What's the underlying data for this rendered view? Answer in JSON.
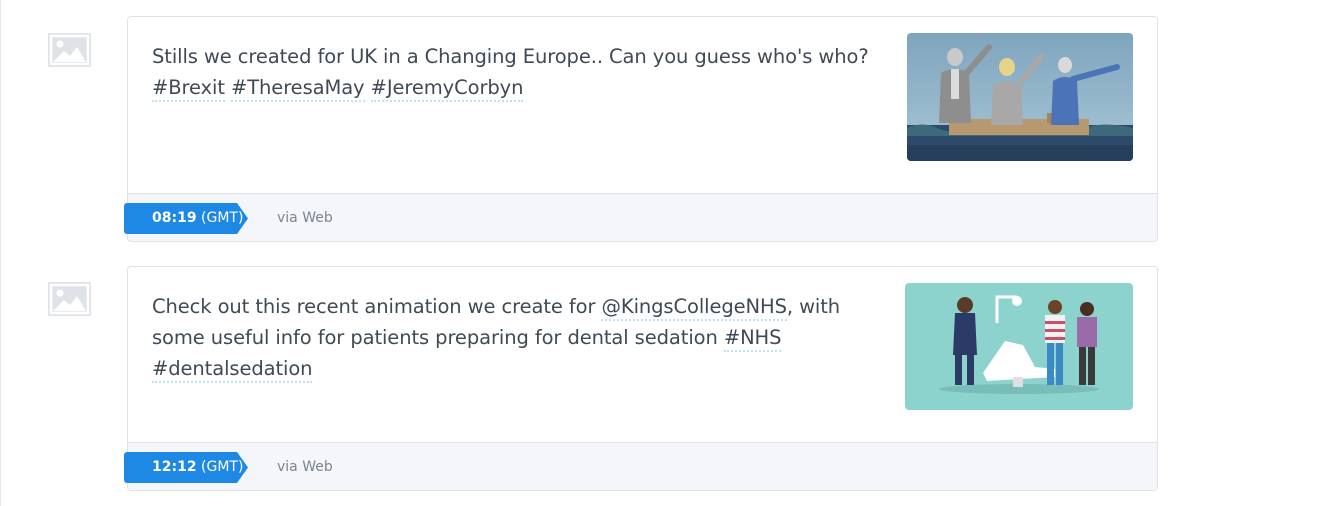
{
  "tweets": [
    {
      "text_parts": [
        {
          "type": "text",
          "value": "Stills we created for UK in a Changing Europe.. Can you guess who's who? "
        },
        {
          "type": "tag",
          "value": "#Brexit"
        },
        {
          "type": "text",
          "value": " "
        },
        {
          "type": "tag",
          "value": "#TheresaMay"
        },
        {
          "type": "text",
          "value": " "
        },
        {
          "type": "tag",
          "value": "#JeremyCorbyn"
        }
      ],
      "time": "08:19",
      "timezone": "(GMT)",
      "via": "via Web",
      "thumbnail_icon": "politicians-illustration-image"
    },
    {
      "text_parts": [
        {
          "type": "text",
          "value": "Check out this recent animation we create for "
        },
        {
          "type": "tag",
          "value": "@KingsCollegeNHS"
        },
        {
          "type": "text",
          "value": ", with some useful info for patients preparing for dental sedation "
        },
        {
          "type": "tag",
          "value": "#NHS"
        },
        {
          "type": "text",
          "value": " "
        },
        {
          "type": "tag",
          "value": "#dentalsedation"
        }
      ],
      "time": "12:12",
      "timezone": "(GMT)",
      "via": "via Web",
      "thumbnail_icon": "dental-clinic-illustration-image"
    }
  ],
  "colors": {
    "badge": "#1e88e5",
    "footer_bg": "#f4f6f9",
    "tag_underline": "#bfe3f0",
    "text": "#3f4a55"
  }
}
